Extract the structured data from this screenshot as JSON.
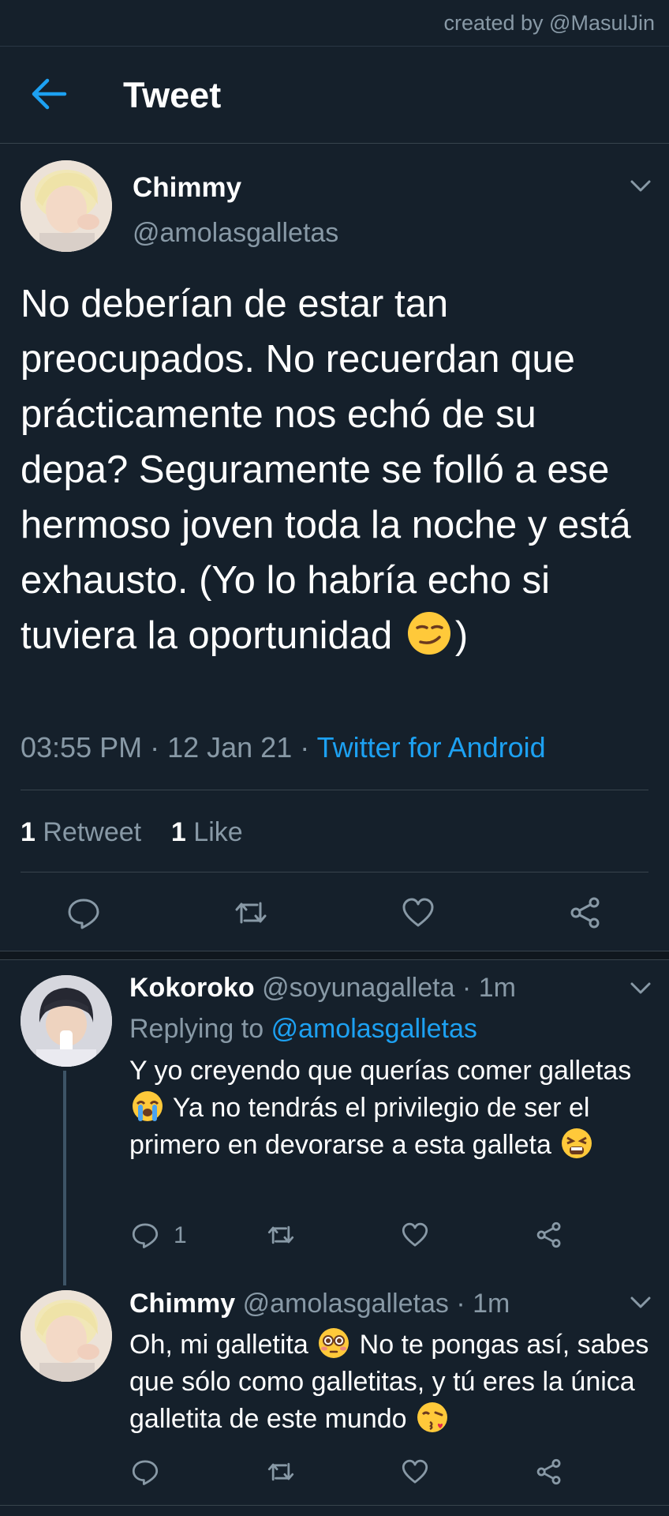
{
  "credit": "created by @MasulJin",
  "header": {
    "title": "Tweet"
  },
  "tweet": {
    "name": "Chimmy",
    "handle": "@amolasgalletas",
    "text_main": "No deberían de estar tan preocupados. No recuerdan que prácticamente nos echó de su depa? Seguramente se folló a ese hermoso joven toda la noche y está exhausto. (Yo lo habría echo si tuviera la oportunidad",
    "text_end": ")",
    "emoji": "smirking-face-emoji",
    "time": "03:55 PM",
    "date": "12 Jan 21",
    "source": "Twitter for Android",
    "retweet_count": "1",
    "retweet_label": "Retweet",
    "like_count": "1",
    "like_label": "Like"
  },
  "replies": [
    {
      "name": "Kokoroko",
      "handle": "@soyunagalleta",
      "time": "1m",
      "replying_label": "Replying to",
      "replying_to": "@amolasgalletas",
      "text_1": "Y yo creyendo que querías comer galletas",
      "text_2": "Ya no tendrás el privilegio de ser el primero en devorarse a esta galleta",
      "emojis": [
        "loudly-crying-face-emoji",
        "tired-face-emoji"
      ],
      "reply_count": "1"
    },
    {
      "name": "Chimmy",
      "handle": "@amolasgalletas",
      "time": "1m",
      "text_1": "Oh, mi galletita",
      "text_2": "No te pongas así, sabes que sólo como galletitas, y tú eres la única galletita de este mundo",
      "emojis": [
        "flushed-face-emoji",
        "face-blowing-kiss-emoji"
      ]
    }
  ],
  "colors": {
    "background": "#15202b",
    "accent": "#1da1f2",
    "secondary_text": "#8899a6",
    "divider": "#38444d"
  }
}
